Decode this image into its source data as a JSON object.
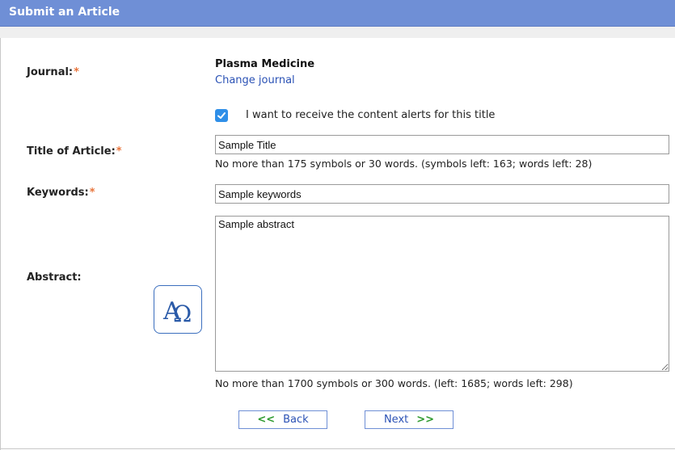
{
  "header": {
    "title": "Submit an Article"
  },
  "form": {
    "journal": {
      "label": "Journal:",
      "required_mark": "*",
      "name": "Plasma Medicine",
      "change_link": "Change journal"
    },
    "alerts": {
      "checked": true,
      "label": "I want to receive the content alerts for this title"
    },
    "title": {
      "label": "Title of Article:",
      "required_mark": "*",
      "value": "Sample Title",
      "hint": "No more than 175 symbols or 30 words. (symbols left: 163; words left: 28)"
    },
    "keywords": {
      "label": "Keywords:",
      "required_mark": "*",
      "value": "Sample keywords"
    },
    "abstract": {
      "label": "Abstract:",
      "value": "Sample abstract",
      "symbol_icon": "alpha-omega-icon",
      "hint": "No more than 1700 symbols or 300 words. (left: 1685; words left: 298)"
    }
  },
  "buttons": {
    "back": {
      "label": "Back",
      "icon": "double-chevron-left-icon",
      "glyph": "<<"
    },
    "next": {
      "label": "Next",
      "icon": "double-chevron-right-icon",
      "glyph": ">>"
    }
  },
  "colors": {
    "header_bg": "#6f8fd6",
    "link": "#2b52b5",
    "required": "#e8743b",
    "checkbox": "#2f8fe8",
    "arrow": "#2e9a2e"
  }
}
